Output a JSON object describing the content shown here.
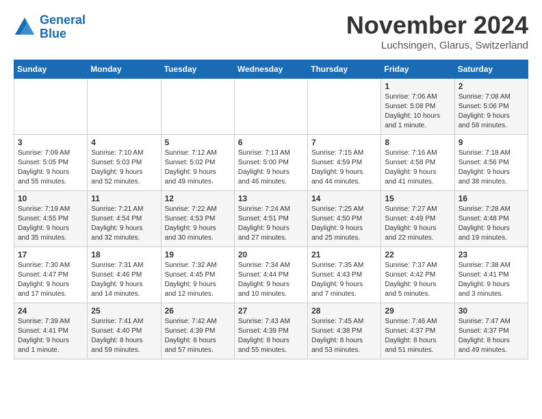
{
  "logo": {
    "line1": "General",
    "line2": "Blue"
  },
  "title": "November 2024",
  "location": "Luchsingen, Glarus, Switzerland",
  "days_header": [
    "Sunday",
    "Monday",
    "Tuesday",
    "Wednesday",
    "Thursday",
    "Friday",
    "Saturday"
  ],
  "weeks": [
    [
      {
        "day": "",
        "info": ""
      },
      {
        "day": "",
        "info": ""
      },
      {
        "day": "",
        "info": ""
      },
      {
        "day": "",
        "info": ""
      },
      {
        "day": "",
        "info": ""
      },
      {
        "day": "1",
        "info": "Sunrise: 7:06 AM\nSunset: 5:08 PM\nDaylight: 10 hours\nand 1 minute."
      },
      {
        "day": "2",
        "info": "Sunrise: 7:08 AM\nSunset: 5:06 PM\nDaylight: 9 hours\nand 58 minutes."
      }
    ],
    [
      {
        "day": "3",
        "info": "Sunrise: 7:09 AM\nSunset: 5:05 PM\nDaylight: 9 hours\nand 55 minutes."
      },
      {
        "day": "4",
        "info": "Sunrise: 7:10 AM\nSunset: 5:03 PM\nDaylight: 9 hours\nand 52 minutes."
      },
      {
        "day": "5",
        "info": "Sunrise: 7:12 AM\nSunset: 5:02 PM\nDaylight: 9 hours\nand 49 minutes."
      },
      {
        "day": "6",
        "info": "Sunrise: 7:13 AM\nSunset: 5:00 PM\nDaylight: 9 hours\nand 46 minutes."
      },
      {
        "day": "7",
        "info": "Sunrise: 7:15 AM\nSunset: 4:59 PM\nDaylight: 9 hours\nand 44 minutes."
      },
      {
        "day": "8",
        "info": "Sunrise: 7:16 AM\nSunset: 4:58 PM\nDaylight: 9 hours\nand 41 minutes."
      },
      {
        "day": "9",
        "info": "Sunrise: 7:18 AM\nSunset: 4:56 PM\nDaylight: 9 hours\nand 38 minutes."
      }
    ],
    [
      {
        "day": "10",
        "info": "Sunrise: 7:19 AM\nSunset: 4:55 PM\nDaylight: 9 hours\nand 35 minutes."
      },
      {
        "day": "11",
        "info": "Sunrise: 7:21 AM\nSunset: 4:54 PM\nDaylight: 9 hours\nand 32 minutes."
      },
      {
        "day": "12",
        "info": "Sunrise: 7:22 AM\nSunset: 4:53 PM\nDaylight: 9 hours\nand 30 minutes."
      },
      {
        "day": "13",
        "info": "Sunrise: 7:24 AM\nSunset: 4:51 PM\nDaylight: 9 hours\nand 27 minutes."
      },
      {
        "day": "14",
        "info": "Sunrise: 7:25 AM\nSunset: 4:50 PM\nDaylight: 9 hours\nand 25 minutes."
      },
      {
        "day": "15",
        "info": "Sunrise: 7:27 AM\nSunset: 4:49 PM\nDaylight: 9 hours\nand 22 minutes."
      },
      {
        "day": "16",
        "info": "Sunrise: 7:28 AM\nSunset: 4:48 PM\nDaylight: 9 hours\nand 19 minutes."
      }
    ],
    [
      {
        "day": "17",
        "info": "Sunrise: 7:30 AM\nSunset: 4:47 PM\nDaylight: 9 hours\nand 17 minutes."
      },
      {
        "day": "18",
        "info": "Sunrise: 7:31 AM\nSunset: 4:46 PM\nDaylight: 9 hours\nand 14 minutes."
      },
      {
        "day": "19",
        "info": "Sunrise: 7:32 AM\nSunset: 4:45 PM\nDaylight: 9 hours\nand 12 minutes."
      },
      {
        "day": "20",
        "info": "Sunrise: 7:34 AM\nSunset: 4:44 PM\nDaylight: 9 hours\nand 10 minutes."
      },
      {
        "day": "21",
        "info": "Sunrise: 7:35 AM\nSunset: 4:43 PM\nDaylight: 9 hours\nand 7 minutes."
      },
      {
        "day": "22",
        "info": "Sunrise: 7:37 AM\nSunset: 4:42 PM\nDaylight: 9 hours\nand 5 minutes."
      },
      {
        "day": "23",
        "info": "Sunrise: 7:38 AM\nSunset: 4:41 PM\nDaylight: 9 hours\nand 3 minutes."
      }
    ],
    [
      {
        "day": "24",
        "info": "Sunrise: 7:39 AM\nSunset: 4:41 PM\nDaylight: 9 hours\nand 1 minute."
      },
      {
        "day": "25",
        "info": "Sunrise: 7:41 AM\nSunset: 4:40 PM\nDaylight: 8 hours\nand 59 minutes."
      },
      {
        "day": "26",
        "info": "Sunrise: 7:42 AM\nSunset: 4:39 PM\nDaylight: 8 hours\nand 57 minutes."
      },
      {
        "day": "27",
        "info": "Sunrise: 7:43 AM\nSunset: 4:39 PM\nDaylight: 8 hours\nand 55 minutes."
      },
      {
        "day": "28",
        "info": "Sunrise: 7:45 AM\nSunset: 4:38 PM\nDaylight: 8 hours\nand 53 minutes."
      },
      {
        "day": "29",
        "info": "Sunrise: 7:46 AM\nSunset: 4:37 PM\nDaylight: 8 hours\nand 51 minutes."
      },
      {
        "day": "30",
        "info": "Sunrise: 7:47 AM\nSunset: 4:37 PM\nDaylight: 8 hours\nand 49 minutes."
      }
    ]
  ]
}
